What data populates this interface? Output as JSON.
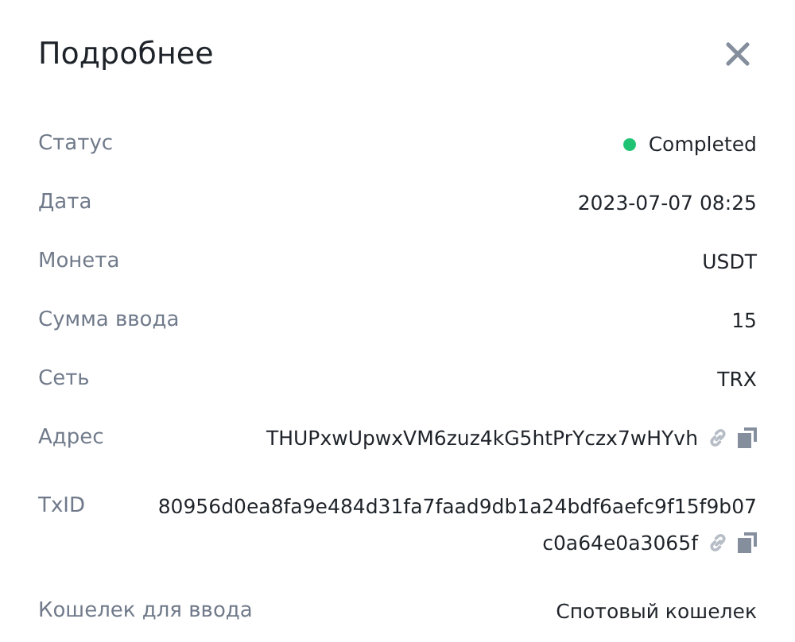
{
  "dialog": {
    "title": "Подробнее"
  },
  "rows": [
    {
      "kind": "status",
      "label": "Статус",
      "value": "Completed",
      "color": "#20c374"
    },
    {
      "kind": "text",
      "label": "Дата",
      "value": "2023-07-07 08:25"
    },
    {
      "kind": "text",
      "label": "Монета",
      "value": "USDT"
    },
    {
      "kind": "text",
      "label": "Сумма ввода",
      "value": "15"
    },
    {
      "kind": "text",
      "label": "Сеть",
      "value": "TRX"
    },
    {
      "kind": "address",
      "label": "Адрес",
      "lines": [
        "THUPxwUpwxVM6zuz4kG5htPrYczx7wHYvh"
      ]
    },
    {
      "kind": "address",
      "label": "TxID",
      "lines": [
        "80956d0ea8fa9e484d31fa7faad9db1a24bdf6aefc9f15f9b07",
        "c0a64e0a3065f"
      ]
    },
    {
      "kind": "text",
      "label": "Кошелек для ввода",
      "value": "Спотовый кошелек"
    }
  ]
}
